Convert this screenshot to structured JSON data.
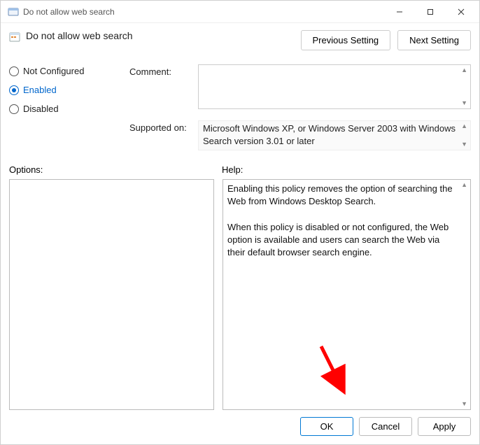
{
  "window": {
    "title": "Do not allow web search"
  },
  "header": {
    "title": "Do not allow web search",
    "prev_label": "Previous Setting",
    "next_label": "Next Setting"
  },
  "radios": {
    "not_configured": "Not Configured",
    "enabled": "Enabled",
    "disabled": "Disabled",
    "selected": "enabled"
  },
  "fields": {
    "comment_label": "Comment:",
    "comment_value": "",
    "supported_label": "Supported on:",
    "supported_value": "Microsoft Windows XP, or Windows Server 2003 with Windows Search version 3.01 or later"
  },
  "panels": {
    "options_label": "Options:",
    "help_label": "Help:",
    "help_p1": "Enabling this policy removes the option of searching the Web from Windows Desktop Search.",
    "help_p2": "When this policy is disabled or not configured, the Web option is available and users can search the Web via their default browser search engine."
  },
  "footer": {
    "ok_label": "OK",
    "cancel_label": "Cancel",
    "apply_label": "Apply"
  }
}
